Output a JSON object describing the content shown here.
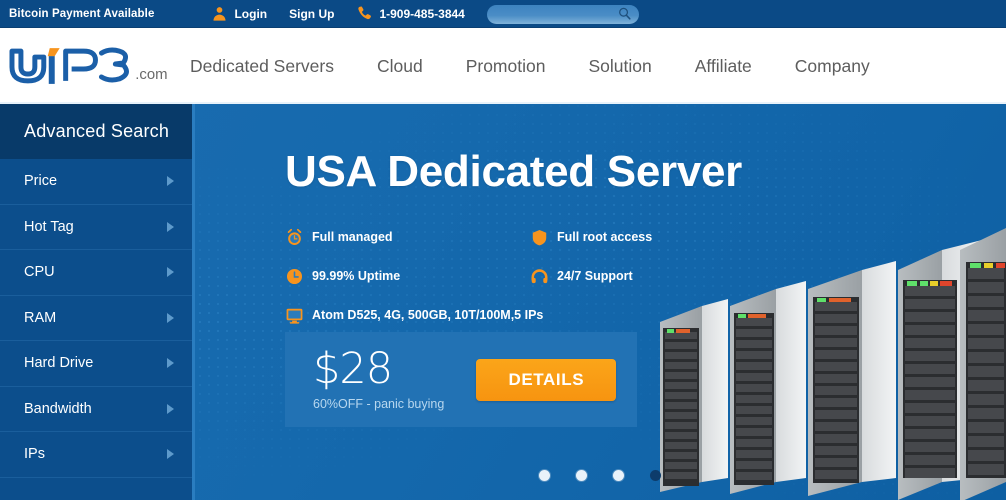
{
  "topbar": {
    "promo": "Bitcoin Payment Available",
    "login": "Login",
    "signup": "Sign Up",
    "phone": "1-909-485-3844",
    "search_placeholder": "",
    "search_value": "",
    "user_icon": "user-icon",
    "phone_icon": "phone-icon",
    "search_icon": "search-icon",
    "bg_color": "#0b4a86",
    "accent_color": "#f7941e"
  },
  "header": {
    "logo_text": "VIP3",
    "logo_suffix": ".com",
    "logo_color": "#1b5fa8",
    "logo_accent": "#f7941e",
    "nav": [
      {
        "label": "Dedicated Servers"
      },
      {
        "label": "Cloud"
      },
      {
        "label": "Promotion"
      },
      {
        "label": "Solution"
      },
      {
        "label": "Affiliate"
      },
      {
        "label": "Company"
      }
    ]
  },
  "sidebar": {
    "title": "Advanced Search",
    "items": [
      {
        "label": "Price"
      },
      {
        "label": "Hot Tag"
      },
      {
        "label": "CPU"
      },
      {
        "label": "RAM"
      },
      {
        "label": "Hard Drive"
      },
      {
        "label": "Bandwidth"
      },
      {
        "label": "IPs"
      }
    ],
    "bg_color": "#0c4e8c",
    "header_bg_color": "#083a69"
  },
  "hero": {
    "title": "USA Dedicated Server",
    "bg_color": "#1569ad",
    "features": [
      {
        "label": "Full managed",
        "icon": "alarm-clock-icon"
      },
      {
        "label": "Full root access",
        "icon": "shield-icon"
      },
      {
        "label": "99.99% Uptime",
        "icon": "clock-icon"
      },
      {
        "label": "24/7 Support",
        "icon": "headset-icon"
      },
      {
        "label": "Atom D525, 4G, 500GB, 10T/100M,5 IPs",
        "icon": "monitor-icon"
      }
    ],
    "price": {
      "amount": "$28",
      "subtitle": "60%OFF - panic buying",
      "button_label": "DETAILS",
      "panel_color": "#2272b4",
      "button_color": "#f79410"
    },
    "carousel": {
      "total": 4,
      "active_index": 3
    },
    "image": "server-rack-illustration"
  }
}
